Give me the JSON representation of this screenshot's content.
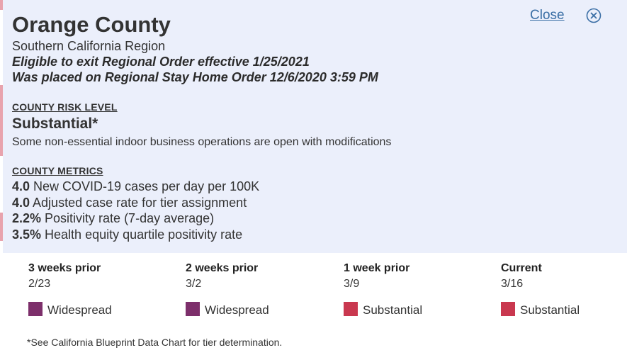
{
  "county": {
    "name": "Orange County",
    "region": "Southern California Region",
    "exit_notice": "Eligible to exit Regional Order effective 1/25/2021",
    "placed_notice": "Was placed on Regional Stay Home Order 12/6/2020 3:59 PM"
  },
  "controls": {
    "close_label": "Close",
    "close_icon": "close-circle-icon"
  },
  "risk": {
    "heading": "COUNTY RISK LEVEL",
    "level": "Substantial*",
    "description": "Some non-essential indoor business operations are open with modifications"
  },
  "metrics": {
    "heading": "COUNTY METRICS",
    "items": [
      {
        "value": "4.0",
        "label": " New COVID-19 cases per day per 100K"
      },
      {
        "value": "4.0",
        "label": " Adjusted case rate for tier assignment"
      },
      {
        "value": "2.2%",
        "label": " Positivity rate (7-day average)"
      },
      {
        "value": "3.5%",
        "label": " Health equity quartile positivity rate"
      }
    ]
  },
  "history": [
    {
      "label": "3 weeks prior",
      "date": "2/23",
      "tier": "Widespread",
      "color": "#7d2f6b"
    },
    {
      "label": "2 weeks prior",
      "date": "3/2",
      "tier": "Widespread",
      "color": "#7d2f6b"
    },
    {
      "label": "1 week prior",
      "date": "3/9",
      "tier": "Substantial",
      "color": "#c9384f"
    },
    {
      "label": "Current",
      "date": "3/16",
      "tier": "Substantial",
      "color": "#c9384f"
    }
  ],
  "footnote": "*See California Blueprint Data Chart for tier determination.",
  "colors": {
    "panel_bg": "#ebeffb",
    "link": "#3a6ea5"
  }
}
